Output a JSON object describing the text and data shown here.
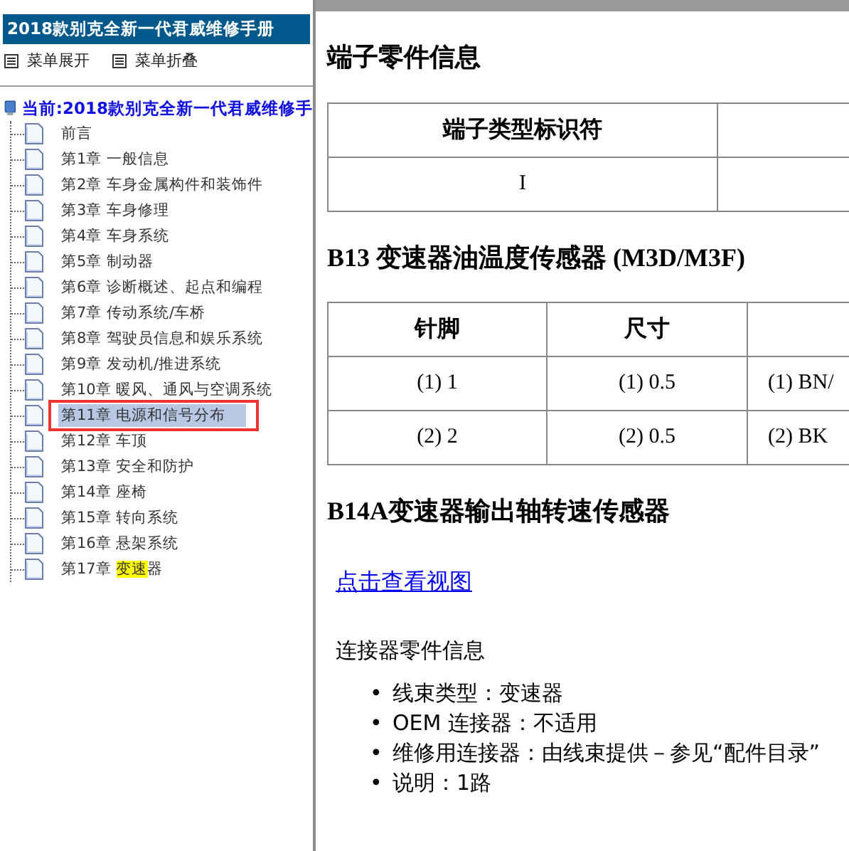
{
  "sidebar": {
    "title": "2018款别克全新一代君威维修手册",
    "toolbar": [
      {
        "label": "菜单展开"
      },
      {
        "label": "菜单折叠"
      }
    ],
    "tree": {
      "label": "当前:2018款别克全新一代君威维修手",
      "children": [
        {
          "label_parts": [
            {
              "text": "前言",
              "highlighted": false
            }
          ],
          "selected": false
        },
        {
          "label_parts": [
            {
              "text": "第1章 一般信息",
              "highlighted": false
            }
          ],
          "selected": false
        },
        {
          "label_parts": [
            {
              "text": "第2章 车身金属构件和装饰件",
              "highlighted": false
            }
          ],
          "selected": false
        },
        {
          "label_parts": [
            {
              "text": "第3章 车身修理",
              "highlighted": false
            }
          ],
          "selected": false
        },
        {
          "label_parts": [
            {
              "text": "第4章 车身系统",
              "highlighted": false
            }
          ],
          "selected": false
        },
        {
          "label_parts": [
            {
              "text": "第5章 制动器",
              "highlighted": false
            }
          ],
          "selected": false
        },
        {
          "label_parts": [
            {
              "text": "第6章 诊断概述、起点和编程",
              "highlighted": false
            }
          ],
          "selected": false
        },
        {
          "label_parts": [
            {
              "text": "第7章 传动系统/车桥",
              "highlighted": false
            }
          ],
          "selected": false
        },
        {
          "label_parts": [
            {
              "text": "第8章 驾驶员信息和娱乐系统",
              "highlighted": false
            }
          ],
          "selected": false
        },
        {
          "label_parts": [
            {
              "text": "第9章 发动机/推进系统",
              "highlighted": false
            }
          ],
          "selected": false
        },
        {
          "label_parts": [
            {
              "text": "第10章 暖风、通风与空调系统",
              "highlighted": false
            }
          ],
          "selected": false
        },
        {
          "label_parts": [
            {
              "text": "第11章 电源和信号分布",
              "highlighted": false
            }
          ],
          "selected": true
        },
        {
          "label_parts": [
            {
              "text": "第12章 车顶",
              "highlighted": false
            }
          ],
          "selected": false
        },
        {
          "label_parts": [
            {
              "text": "第13章 安全和防护",
              "highlighted": false
            }
          ],
          "selected": false
        },
        {
          "label_parts": [
            {
              "text": "第14章 座椅",
              "highlighted": false
            }
          ],
          "selected": false
        },
        {
          "label_parts": [
            {
              "text": "第15章 转向系统",
              "highlighted": false
            }
          ],
          "selected": false
        },
        {
          "label_parts": [
            {
              "text": "第16章 悬架系统",
              "highlighted": false
            }
          ],
          "selected": false
        },
        {
          "label_parts": [
            {
              "text": "第17章 ",
              "highlighted": false
            },
            {
              "text": "变速",
              "highlighted": true
            },
            {
              "text": "器",
              "highlighted": false
            }
          ],
          "selected": false
        }
      ]
    }
  },
  "content": [
    {
      "kind": "heading",
      "text": "端子零件信息"
    },
    {
      "kind": "table",
      "columns": [
        "端子类型标识符",
        ""
      ],
      "rows": [
        [
          "I",
          ""
        ]
      ]
    },
    {
      "kind": "heading",
      "text": "B13 变速器油温度传感器 (M3D/M3F)"
    },
    {
      "kind": "table",
      "columns": [
        "针脚",
        "尺寸",
        ""
      ],
      "rows": [
        [
          "(1) 1",
          "(1) 0.5",
          "(1) BN/"
        ],
        [
          "(2) 2",
          "(2) 0.5",
          "(2) BK"
        ]
      ]
    },
    {
      "kind": "heading",
      "text": "B14A变速器输出轴转速传感器"
    },
    {
      "kind": "link",
      "text": "点击查看视图"
    },
    {
      "kind": "paragraph",
      "text": "连接器零件信息"
    },
    {
      "kind": "bullets",
      "items": [
        {
          "marker": "•",
          "text": "线束类型：变速器"
        },
        {
          "marker": "•",
          "text": "OEM 连接器：不适用"
        },
        {
          "marker": "•",
          "text": "维修用连接器：由线束提供－参见“配件目录”"
        },
        {
          "marker": "•",
          "text": "说明：1路"
        }
      ]
    }
  ]
}
